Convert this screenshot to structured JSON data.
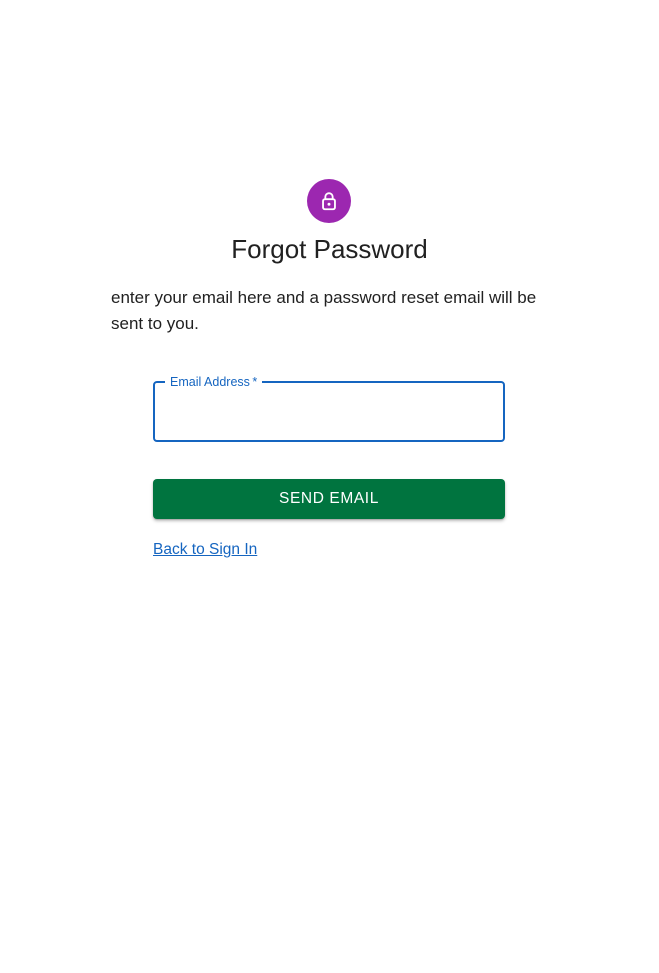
{
  "header": {
    "avatar_icon": "lock-icon",
    "avatar_color": "#9c27b0",
    "title": "Forgot Password"
  },
  "instructions": "enter your email here and a password reset email will be sent to you.",
  "form": {
    "email_label": "Email Address",
    "email_required_marker": "*",
    "email_value": "",
    "send_button_label": "SEND EMAIL",
    "send_button_color": "#00743f"
  },
  "links": {
    "back_to_sign_in": "Back to Sign In"
  },
  "colors": {
    "focus_accent": "#1565c0",
    "text_primary": "#212121"
  }
}
